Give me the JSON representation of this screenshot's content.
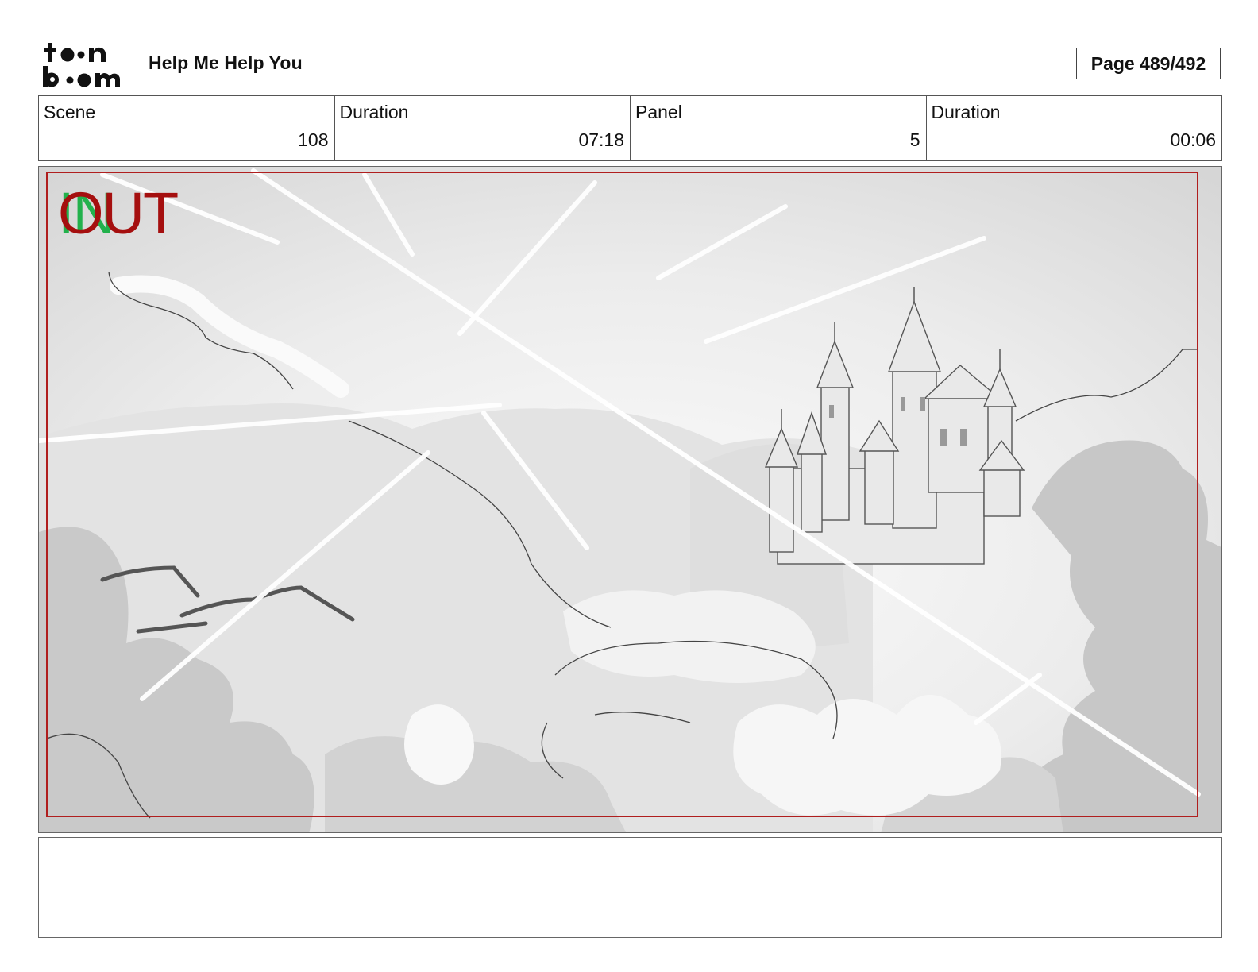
{
  "header": {
    "logo_text": "toon boom",
    "project_title": "Help Me Help You",
    "page_label": "Page 489/492"
  },
  "info": [
    {
      "label": "Scene",
      "value": "108"
    },
    {
      "label": "Duration",
      "value": "07:18"
    },
    {
      "label": "Panel",
      "value": "5"
    },
    {
      "label": "Duration",
      "value": "00:06"
    }
  ],
  "panel": {
    "in_marker": "IN",
    "out_marker": "OUT",
    "in_color": "#22b14c",
    "out_color": "#a50f0f",
    "safe_frame_color": "#b01e1e",
    "artwork": "castle-sketch-drawing"
  },
  "notes": {
    "text": ""
  }
}
